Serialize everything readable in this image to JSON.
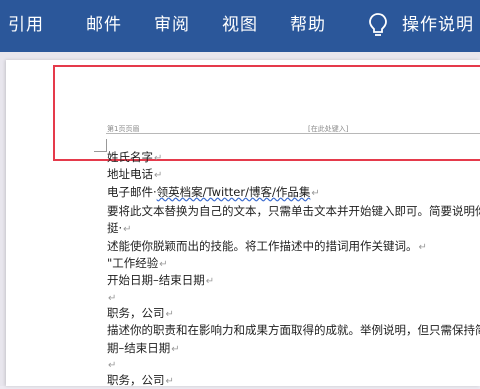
{
  "ribbon": {
    "tabs": [
      "引用",
      "邮件",
      "审阅",
      "视图",
      "帮助"
    ],
    "tell_me": "操作说明"
  },
  "header": {
    "left_label": "第1页页眉",
    "placeholder": "[在此处键入]"
  },
  "document": {
    "lines": [
      {
        "text": "姓氏名字",
        "mark": "↵"
      },
      {
        "text": "地址电话",
        "mark": "↵"
      },
      {
        "pre": "电子邮件·",
        "link": "领英档案/Twitter/博客/作品集",
        "mark": "↵"
      },
      {
        "text": "要将此文本替换为自己的文本，只需单击文本并开始键入即可。简要说明你的",
        "mark": ""
      },
      {
        "text": "挺·",
        "mark": "↵"
      },
      {
        "text": "述能使你脱颖而出的技能。将工作描述中的措词用作关键词。",
        "mark": "↵"
      },
      {
        "text": "\"工作经验",
        "mark": "↵"
      },
      {
        "text": "开始日期–结束日期",
        "mark": "↵"
      },
      {
        "text": "",
        "mark": "↵"
      },
      {
        "text": "职务，公司",
        "mark": "↵"
      },
      {
        "text": "描述你的职责和在影响力和成果方面取得的成就。举例说明，但只需保持简",
        "mark": ""
      },
      {
        "text": "期–结束日期",
        "mark": "↵"
      },
      {
        "text": "",
        "mark": "↵"
      },
      {
        "text": "职务，公司",
        "mark": "↵"
      }
    ]
  },
  "colors": {
    "ribbon": "#2b579a",
    "highlight_box": "#e53a4b"
  }
}
